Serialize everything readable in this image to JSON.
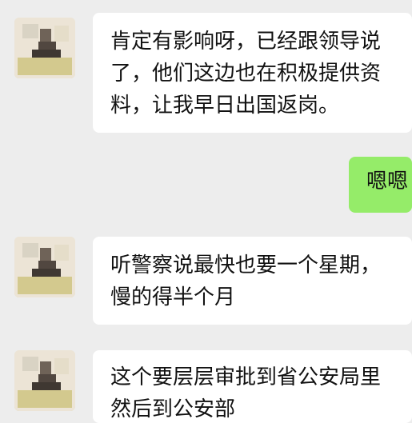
{
  "messages": [
    {
      "sender": "other",
      "lines": [
        "肯定有影响呀，已经跟领导说",
        "了，他们这边也在积极提供资",
        "料，让我早日出国返岗。"
      ]
    },
    {
      "sender": "self",
      "lines": [
        "嗯嗯"
      ]
    },
    {
      "sender": "other",
      "lines": [
        "听警察说最快也要一个星期，",
        "慢的得半个月"
      ]
    },
    {
      "sender": "other",
      "lines": [
        "这个要层层审批到省公安局里",
        "然后到公安部"
      ]
    }
  ],
  "colors": {
    "background": "#ededed",
    "bubble_other": "#ffffff",
    "bubble_self": "#95ec69"
  },
  "icons": {
    "avatar": "blurred-contact-avatar"
  }
}
